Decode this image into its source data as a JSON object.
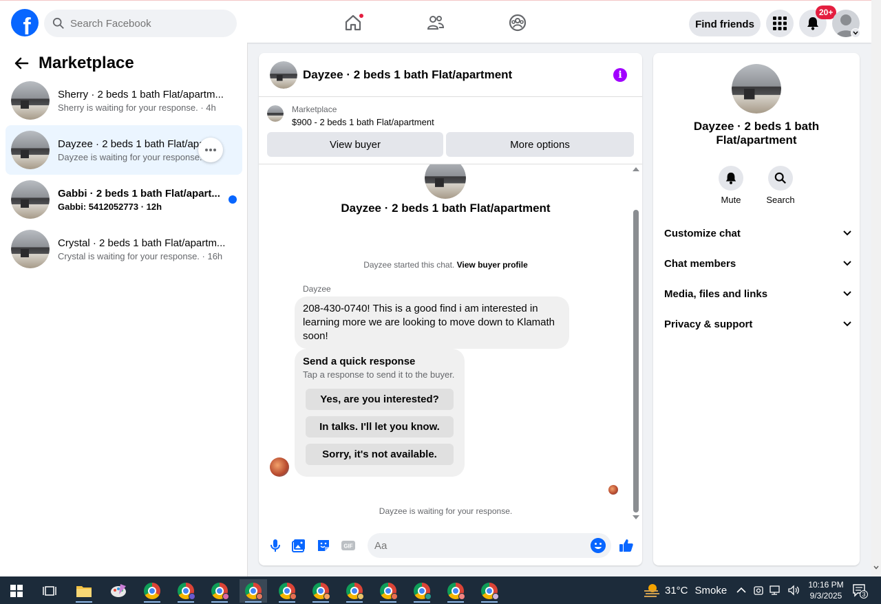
{
  "header": {
    "search_placeholder": "Search Facebook",
    "find_friends": "Find friends",
    "notification_count": "20+"
  },
  "sidebar": {
    "title": "Marketplace",
    "conversations": [
      {
        "title": "Sherry · 2 beds 1 bath Flat/apartm...",
        "preview": "Sherry is waiting for your response. · 4h",
        "unread": false
      },
      {
        "title": "Dayzee · 2 beds 1 bath Flat/apa...",
        "preview": "Dayzee is waiting for your response.",
        "unread": false
      },
      {
        "title": "Gabbi · 2 beds 1 bath Flat/apart...",
        "preview": "Gabbi: 5412052773 · 12h",
        "unread": true
      },
      {
        "title": "Crystal · 2 beds 1 bath Flat/apartm...",
        "preview": "Crystal is waiting for your response. · 16h",
        "unread": false
      }
    ]
  },
  "chat": {
    "title": "Dayzee · 2 beds 1 bath Flat/apartment",
    "listing_label": "Marketplace",
    "listing_desc": "$900 - 2 beds 1 bath Flat/apartment",
    "view_buyer": "View buyer",
    "more_options": "More options",
    "started_text": "Dayzee started this chat.",
    "view_buyer_profile": "View buyer profile",
    "sender": "Dayzee",
    "message": "208-430-0740! This is a good find i am interested in learning more we are looking to move down to Klamath soon!",
    "quick_title": "Send a quick response",
    "quick_sub": "Tap a response to send it to the buyer.",
    "quick_responses": [
      "Yes, are you interested?",
      "In talks. I'll let you know.",
      "Sorry, it's not available."
    ],
    "waiting_text": "Dayzee is waiting for your response.",
    "input_placeholder": "Aa"
  },
  "details": {
    "name": "Dayzee · 2 beds 1 bath Flat/apartment",
    "mute": "Mute",
    "search": "Search",
    "rows": [
      "Customize chat",
      "Chat members",
      "Media, files and links",
      "Privacy & support"
    ]
  },
  "taskbar": {
    "temperature": "31°C",
    "weather": "Smoke",
    "time": "10:16 PM",
    "date": "9/3/2025",
    "notifications": "3"
  },
  "colors": {
    "brand": "#0866ff",
    "badge": "#e41e3f",
    "info": "#a100ff"
  }
}
